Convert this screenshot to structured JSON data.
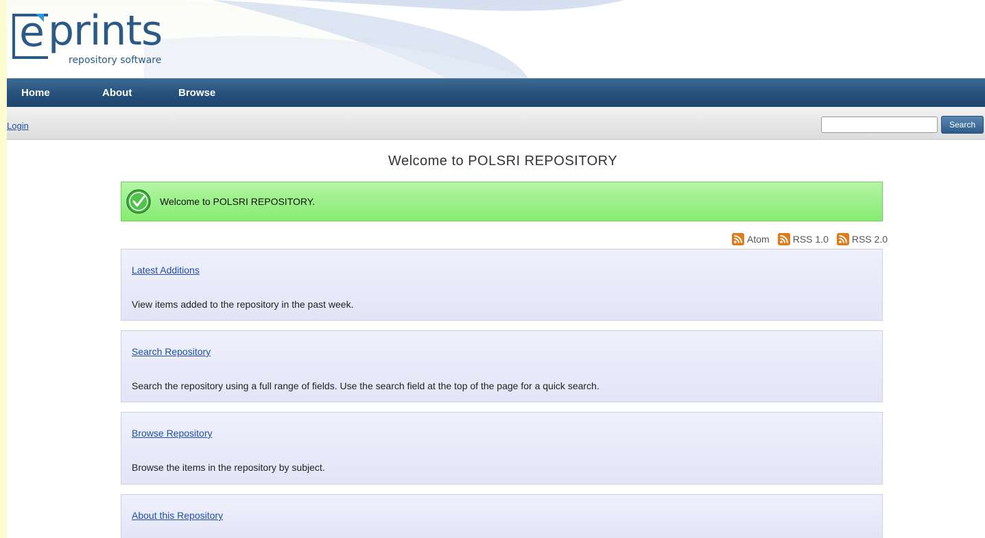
{
  "header": {
    "logo_word": "prints",
    "logo_e": "e",
    "logo_subtitle": "repository software"
  },
  "nav": {
    "items": [
      {
        "label": "Home"
      },
      {
        "label": "About"
      },
      {
        "label": "Browse"
      }
    ]
  },
  "toolbar": {
    "login_label": "Login",
    "search_value": "",
    "search_button_label": "Search"
  },
  "main": {
    "title": "Welcome to POLSRI REPOSITORY",
    "welcome_message": "Welcome to POLSRI REPOSITORY.",
    "feeds": [
      {
        "label": "Atom",
        "icon": "rss-icon"
      },
      {
        "label": "RSS 1.0",
        "icon": "rss-icon"
      },
      {
        "label": "RSS 2.0",
        "icon": "rss-icon"
      }
    ],
    "cards": [
      {
        "link": "Latest Additions",
        "description": "View items added to the repository in the past week."
      },
      {
        "link": "Search Repository",
        "description": "Search the repository using a full range of fields. Use the search field at the top of the page for a quick search."
      },
      {
        "link": "Browse Repository",
        "description": "Browse the items in the repository by subject."
      },
      {
        "link": "About this Repository",
        "description": ""
      }
    ]
  },
  "colors": {
    "brand": "#2b5a86",
    "navbar": "#26507a",
    "success": "#86ec70",
    "link": "#1f4fa8",
    "feed": "#e07a1a",
    "page_background": "#fdfbd0"
  }
}
